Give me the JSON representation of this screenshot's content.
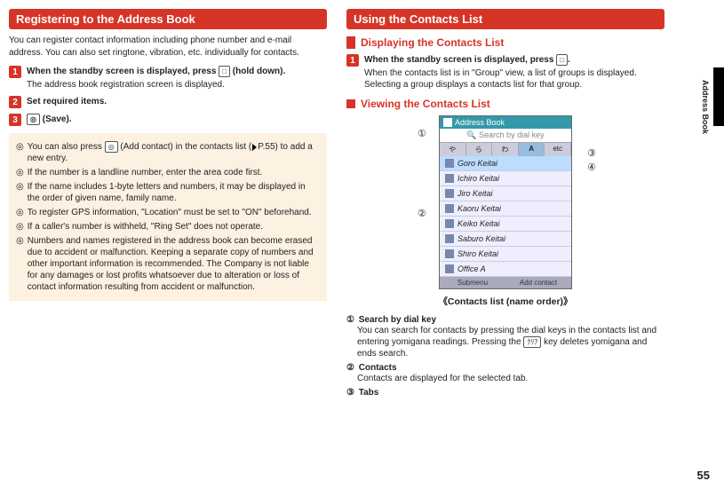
{
  "left": {
    "section_title": "Registering to the Address Book",
    "intro": "You can register contact information including phone number and e-mail address. You can also set ringtone, vibration, etc. individually for contacts.",
    "step1": {
      "title_a": "When the standby screen is displayed, press ",
      "key": "□",
      "title_b": " (hold down).",
      "desc": "The address book registration screen is displayed."
    },
    "step2": {
      "title": "Set required items."
    },
    "step3": {
      "title_a": "",
      "key": "◎",
      "title_b": " (Save)."
    },
    "notes": [
      {
        "a": "You can also press ",
        "key": "◎",
        "b": " (Add contact) in the contacts list (",
        "c": "P.55) to add a new entry."
      },
      {
        "text": "If the number is a landline number, enter the area code first."
      },
      {
        "text": "If the name includes 1-byte letters and numbers, it may be displayed in the order of given name, family name."
      },
      {
        "text": "To register GPS information, \"Location\" must be set to \"ON\" beforehand."
      },
      {
        "text": "If a caller's number is withheld, \"Ring Set\" does not operate."
      },
      {
        "text": "Numbers and names registered in the address book can become erased due to accident or malfunction. Keeping a separate copy of numbers and other important information is recommended. The Company is not liable for any damages or lost profits whatsoever due to alteration or loss of contact information resulting from accident or malfunction."
      }
    ]
  },
  "right": {
    "section_title": "Using the Contacts List",
    "sub1": "Displaying the Contacts List",
    "step1": {
      "title_a": "When the standby screen is displayed, press ",
      "key": "□",
      "title_b": ".",
      "desc": "When the contacts list is in \"Group\" view, a list of groups is displayed. Selecting a group displays a contacts list for that group."
    },
    "sub2": "Viewing the Contacts List",
    "phone": {
      "header": "Address Book",
      "search_placeholder": "Search by dial key",
      "tabs": [
        "や",
        "ら",
        "わ",
        "A",
        "etc"
      ],
      "selected_tab_index": 3,
      "items": [
        "Goro Keitai",
        "Ichiro Keitai",
        "Jiro Keitai",
        "Kaoru Keitai",
        "Keiko Keitai",
        "Saburo Keitai",
        "Shiro Keitai",
        "Office A"
      ],
      "selected_item_index": 0,
      "soft_left": "Submenu",
      "soft_right": "Add contact"
    },
    "caption": "《Contacts list (name order)》",
    "callouts": {
      "1": "①",
      "2": "②",
      "3": "③",
      "4": "④"
    },
    "defs": {
      "d1": {
        "num": "①",
        "head": "Search by dial key",
        "body_a": "You can search for contacts by pressing the dial keys in the contacts list and entering yomigana readings. Pressing the ",
        "key": "ｸﾘｱ",
        "body_b": " key deletes yomigana and ends search."
      },
      "d2": {
        "num": "②",
        "head": "Contacts",
        "body": "Contacts are displayed for the selected tab."
      },
      "d3": {
        "num": "③",
        "head": "Tabs"
      }
    }
  },
  "edge_label": "Address Book",
  "page_number": "55"
}
